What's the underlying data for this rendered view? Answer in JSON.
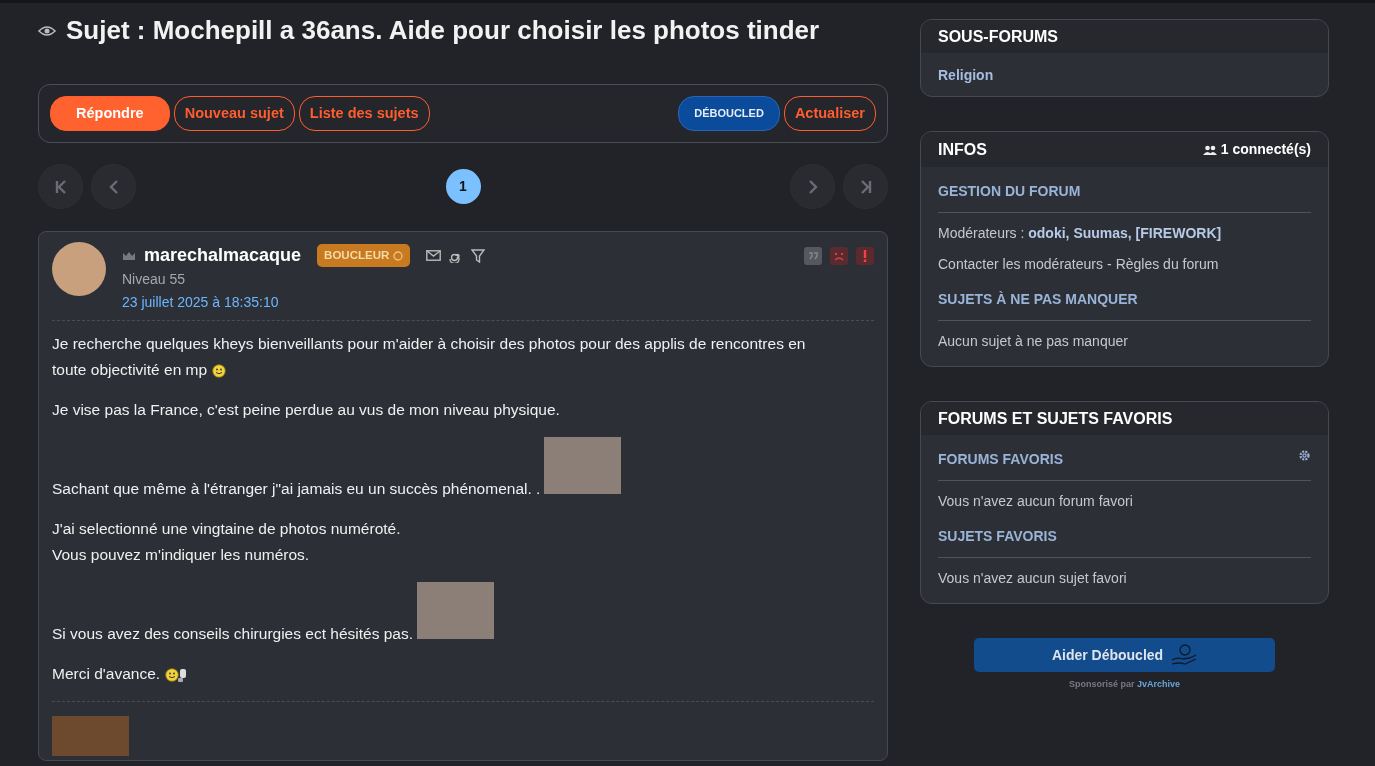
{
  "topic": {
    "title": "Sujet : Mochepill a 36ans. Aide pour choisir les photos tinder"
  },
  "toolbar": {
    "left": [
      {
        "label": "Répondre",
        "kind": "primary"
      },
      {
        "label": "Nouveau sujet",
        "kind": "outline"
      },
      {
        "label": "Liste des sujets",
        "kind": "outline"
      }
    ],
    "right": [
      {
        "label": "DÉBOUCLED",
        "kind": "brand"
      },
      {
        "label": "Actualiser",
        "kind": "outline"
      }
    ]
  },
  "pagination": {
    "pages": [
      {
        "label": "1",
        "selected": true
      }
    ]
  },
  "post": {
    "author": "marechalmacaque",
    "badge": "BOUCLEUR",
    "level": "Niveau 55",
    "date": "23 juillet 2025 à 18:35:10",
    "paragraphs": [
      {
        "kind": "smiley",
        "lines": [
          "Je recherche quelques kheys bienveillants pour m'aider à choisir des photos pour des applis de rencontres en",
          "toute objectivité en mp"
        ]
      },
      {
        "kind": "plain",
        "lines": [
          "Je vise pas la France, c'est peine perdue au vus de mon niveau physique."
        ]
      },
      {
        "kind": "sticker",
        "lines": [
          "Sachant que même à l'étranger j\"ai jamais eu un succès phénomenal. ."
        ]
      },
      {
        "kind": "plain",
        "lines": [
          "J'ai selectionné une vingtaine de photos numéroté.",
          "Vous pouvez m'indiquer les numéros."
        ]
      },
      {
        "kind": "sticker",
        "lines": [
          "Si vous avez des conseils chirurgies ect hésités pas."
        ]
      },
      {
        "kind": "emoticons",
        "lines": [
          "Merci d'avance."
        ]
      }
    ]
  },
  "sidebar": {
    "subforums": {
      "title": "SOUS-FORUMS",
      "items": [
        "Religion"
      ]
    },
    "infos": {
      "title": "INFOS",
      "online": "1 connecté(s)",
      "sections": [
        {
          "heading": "GESTION DU FORUM",
          "lines": [
            [
              {
                "kind": "text",
                "text": "Modérateurs : **odoki, Suumas, [FIREWORK]**"
              }
            ],
            [
              {
                "kind": "link",
                "text": "Contacter les modérateurs"
              },
              {
                "kind": "text",
                "text": "-"
              },
              {
                "kind": "link",
                "text": "Règles du forum"
              }
            ]
          ]
        },
        {
          "heading": "SUJETS À NE PAS MANQUER",
          "lines": [
            [
              {
                "kind": "text",
                "text": "Aucun sujet à ne pas manquer"
              }
            ]
          ]
        }
      ]
    },
    "favorites": {
      "title": "FORUMS ET SUJETS FAVORIS",
      "sections": [
        {
          "heading": "FORUMS FAVORIS",
          "settings": true,
          "lines": [
            [
              {
                "kind": "text",
                "text": "Vous n'avez aucun forum favori"
              }
            ]
          ]
        },
        {
          "heading": "SUJETS FAVORIS",
          "lines": [
            [
              {
                "kind": "text",
                "text": "Vous n'avez aucun sujet favori"
              }
            ]
          ]
        }
      ]
    },
    "donate": {
      "label": "Aider Déboucled",
      "sponsor_text": "Sponsorisé par",
      "sponsor_link": "JvArchive"
    }
  }
}
